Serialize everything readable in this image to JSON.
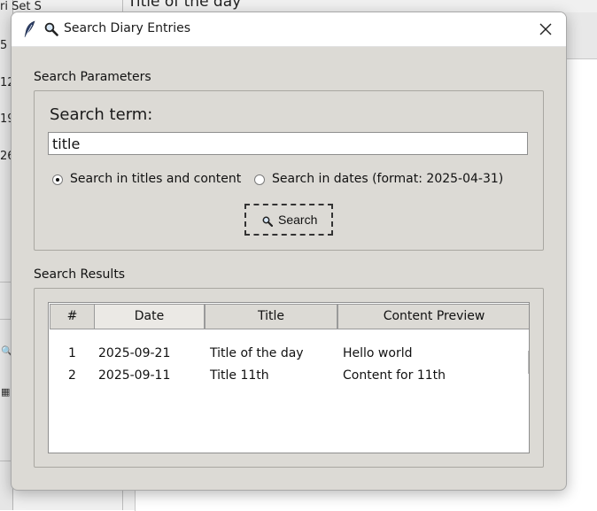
{
  "background": {
    "title_text": "Title of the day",
    "header_fragment": "ri     Set      S",
    "calendar_numbers": [
      "5",
      "12",
      "19",
      "26"
    ]
  },
  "dialog": {
    "title": "Search Diary Entries",
    "icons": {
      "app": "feather-icon",
      "title": "magnifier-icon",
      "close": "close-icon"
    },
    "parameters": {
      "group_label": "Search Parameters",
      "search_term_label": "Search term:",
      "search_term_value": "title",
      "radio_options": [
        {
          "label": "Search in titles and content",
          "checked": true
        },
        {
          "label": "Search in dates (format: 2025-04-31)",
          "checked": false
        }
      ],
      "search_button_label": "Search"
    },
    "results": {
      "group_label": "Search Results",
      "columns": [
        "#",
        "Date",
        "Title",
        "Content Preview"
      ],
      "rows": [
        {
          "num": "1",
          "date": "2025-09-21",
          "title": "Title of the day",
          "preview": "Hello world"
        },
        {
          "num": "2",
          "date": "2025-09-11",
          "title": "Title 11th",
          "preview": "Content for 11th"
        }
      ]
    }
  },
  "colors": {
    "dialog_bg": "#dcdad5",
    "titlebar_bg": "#ffffff",
    "selected_header_bg": "#ebe9e5"
  }
}
